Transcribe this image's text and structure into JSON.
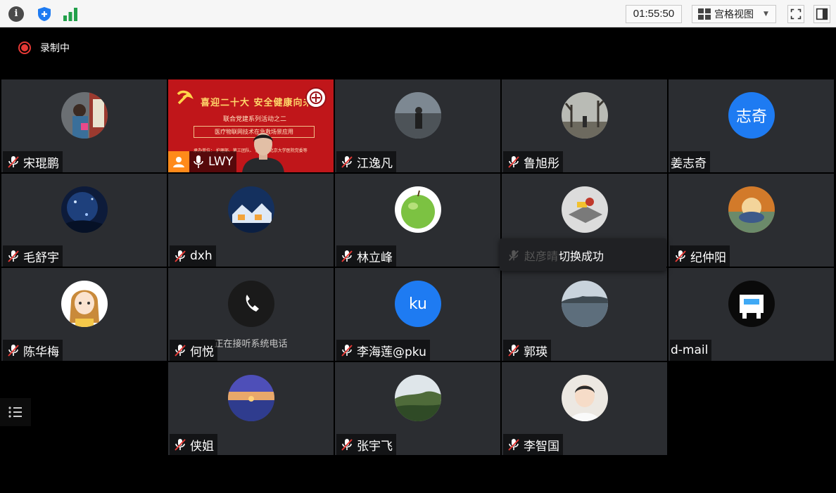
{
  "toolbar": {
    "timer": "01:55:50",
    "view_label": "宫格视图",
    "info_icon_glyph": "i"
  },
  "recording": {
    "label": "录制中"
  },
  "speaker": {
    "name": "LWY",
    "banner_title": "喜迎二十大 安全健康向未来",
    "banner_sub": "联合党建系列活动之二",
    "banner_box": "医疗物联网技术在急救场景应用",
    "banner_small": "承办单位：   护理部、第三团队、\n医学部  北京大学医院党委等"
  },
  "participants": [
    {
      "name": "宋琨鹏",
      "avatar": "photo-person"
    },
    {
      "name": "江逸凡",
      "avatar": "photo-person-coast"
    },
    {
      "name": "鲁旭彤",
      "avatar": "photo-trees"
    },
    {
      "name": "姜志奇",
      "avatar_text": "志奇",
      "no_mic": true
    },
    {
      "name": "毛舒宇",
      "avatar": "photo-night-sky"
    },
    {
      "name": "dxh",
      "avatar": "photo-snow-village"
    },
    {
      "name": "林立峰",
      "avatar": "photo-apple"
    },
    {
      "name": "纪仲阳",
      "avatar": "photo-painting"
    },
    {
      "name": "陈华梅",
      "avatar": "cartoon-girl"
    },
    {
      "name": "何悦",
      "avatar": "phone-icon",
      "status": "正在接听系统电话"
    },
    {
      "name": "李海莲@pku",
      "avatar_text": "ku"
    },
    {
      "name": "郭瑛",
      "avatar": "photo-lake"
    },
    {
      "name": "d-mail",
      "avatar": "pixel-dog",
      "no_mic": true
    },
    {
      "name": "侠姐",
      "avatar": "photo-sunset"
    },
    {
      "name": "张宇飞",
      "avatar": "photo-forest"
    },
    {
      "name": "李智国",
      "avatar": "photo-baby"
    }
  ],
  "toast": {
    "behind_name": "赵彦晴",
    "message": "切换成功"
  },
  "colors": {
    "accent": "#1e7bf2",
    "recording": "#e53935",
    "speaker_bg": "#c0161a",
    "orange": "#ff8a1a"
  }
}
